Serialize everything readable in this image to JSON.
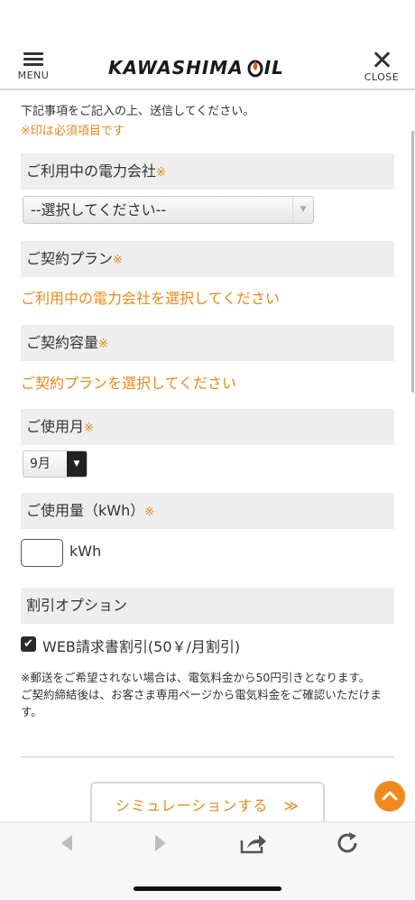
{
  "header": {
    "menu_label": "MENU",
    "close_label": "CLOSE",
    "logo_text_left": "KAWASHIMA",
    "logo_text_right": "IL"
  },
  "intro": {
    "instruction": "下記事項をご記入の上、送信してください。",
    "required_note": "※印は必須項目です"
  },
  "required_mark": "※",
  "sections": {
    "power_company": {
      "label": "ご利用中の電力会社",
      "select_value": "--選択してください--"
    },
    "contract_plan": {
      "label": "ご契約プラン",
      "message": "ご利用中の電力会社を選択してください"
    },
    "contract_capacity": {
      "label": "ご契約容量",
      "message": "ご契約プランを選択してください"
    },
    "usage_month": {
      "label": "ご使用月",
      "select_value": "9月"
    },
    "usage_amount": {
      "label": "ご使用量（kWh）",
      "input_value": "",
      "unit": "kWh"
    },
    "discount": {
      "label": "割引オプション",
      "checkbox_label": "WEB請求書割引(50￥/月割引)",
      "checked": true
    }
  },
  "notes": [
    "※郵送をご希望されない場合は、電気料金から50円引きとなります。",
    "ご契約締結後は、お客さま専用ページから電気料金をご確認いただけます。"
  ],
  "simulate_button": "シミュレーションする　≫",
  "colors": {
    "accent": "#e48a1c",
    "section_bg": "#eeeeee",
    "scroll_top_bg": "#f08a1e"
  },
  "icons": {
    "menu": "hamburger-icon",
    "close": "close-icon",
    "back": "back-arrow-icon",
    "forward": "forward-arrow-icon",
    "share": "share-icon",
    "reload": "reload-icon",
    "scroll_top": "chevron-up-icon"
  }
}
